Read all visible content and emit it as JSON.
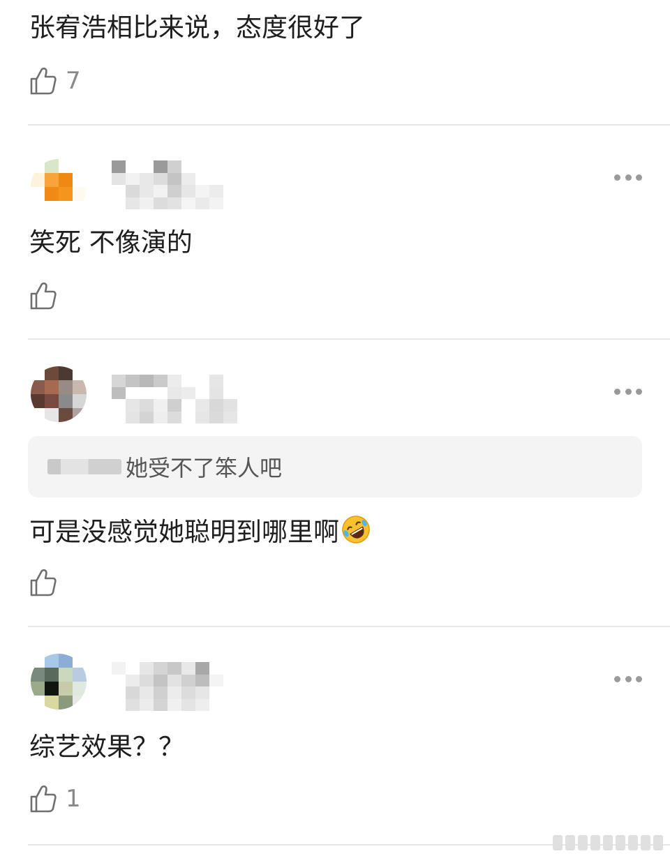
{
  "comments": [
    {
      "text": "张宥浩相比来说，态度很好了",
      "likes": "7"
    },
    {
      "text": "笑死 不像演的",
      "likes": ""
    },
    {
      "quote": "她受不了笨人吧",
      "text": "可是没感觉她聪明到哪里啊",
      "emoji": "rolling-on-floor-laughing-emoji",
      "likes": ""
    },
    {
      "text": "综艺效果？？",
      "likes": "1"
    }
  ],
  "icons": {
    "like": "thumbs-up-icon",
    "more": "more-dots-icon"
  },
  "colors": {
    "text": "#1e1e1e",
    "muted": "#8a8a8a",
    "divider": "#e6e6e6",
    "quote_bg": "#f4f4f4"
  }
}
